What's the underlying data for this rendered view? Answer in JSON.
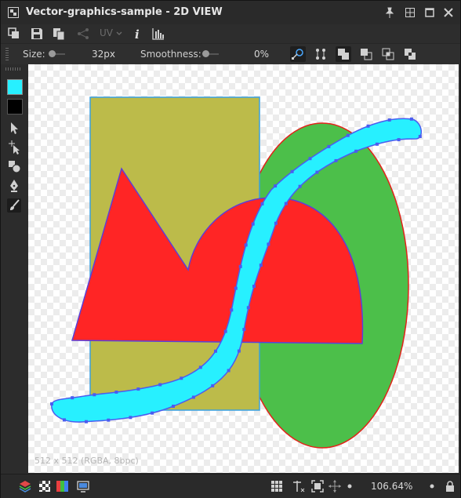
{
  "window": {
    "title": "Vector-graphics-sample - 2D VIEW"
  },
  "titlebar_buttons": [
    "pin-icon",
    "tile-icon",
    "maximize-icon",
    "close-icon"
  ],
  "toolbar": {
    "uv_label": "UV",
    "icons": [
      "new-layer-icon",
      "save-icon",
      "copy-icon",
      "share-icon",
      "uv-dropdown-icon",
      "info-icon",
      "histogram-icon"
    ]
  },
  "options": {
    "size_label": "Size:",
    "size_value": "32px",
    "size_level": 0.0,
    "smoothness_label": "Smoothness:",
    "smoothness_value": "0%",
    "smoothness_level": 0.0
  },
  "tools": {
    "foreground_color": "#27f0ff",
    "background_color": "#000000",
    "items": [
      "select-arrow-icon",
      "direct-select-icon",
      "shapes-icon",
      "pen-icon",
      "brush-icon"
    ]
  },
  "canvas": {
    "image_info": "512 x 512 (RGBA, 8bpc)",
    "shapes": [
      {
        "name": "green-ellipse",
        "fill": "#4cbf4a",
        "stroke": "#e2231a"
      },
      {
        "name": "olive-rectangle",
        "fill": "#bcbb4a",
        "stroke": "#3aa0e0"
      },
      {
        "name": "red-shape",
        "fill": "#ff2525",
        "stroke": "#5b3fd8"
      },
      {
        "name": "cyan-stroke-path",
        "fill": "#27f0ff",
        "stroke": "#4b5cf0"
      }
    ]
  },
  "status": {
    "zoom": "106.64%"
  }
}
